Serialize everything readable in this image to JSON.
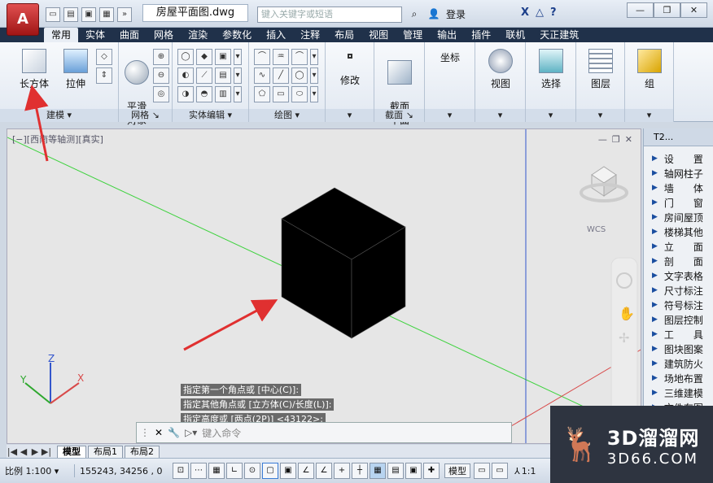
{
  "app": {
    "logo_label": "A",
    "doc_title": "房屋平面图.dwg",
    "search_placeholder": "键入关键字或短语",
    "login_label": "登录",
    "help_label": "?"
  },
  "quick_access": [
    "new-icon",
    "open-icon",
    "save-icon",
    "saveas-icon",
    "more-icon"
  ],
  "window_controls": {
    "minimize": "—",
    "restore": "❐",
    "close": "✕"
  },
  "tabs": [
    {
      "label": "常用",
      "active": true
    },
    {
      "label": "实体"
    },
    {
      "label": "曲面"
    },
    {
      "label": "网格"
    },
    {
      "label": "渲染"
    },
    {
      "label": "参数化"
    },
    {
      "label": "插入"
    },
    {
      "label": "注释"
    },
    {
      "label": "布局"
    },
    {
      "label": "视图"
    },
    {
      "label": "管理"
    },
    {
      "label": "输出"
    },
    {
      "label": "插件"
    },
    {
      "label": "联机"
    },
    {
      "label": "天正建筑"
    }
  ],
  "ribbon": {
    "modeling": {
      "title": "建模 ▾",
      "box_label": "长方体",
      "extrude_label": "拉伸"
    },
    "mesh": {
      "title": "网格 ↘",
      "smooth_label": "平滑\n对象"
    },
    "solid_edit": {
      "title": "实体编辑 ▾"
    },
    "draw": {
      "title": "绘图 ▾"
    },
    "modify": {
      "label": "修改"
    },
    "section": {
      "title": "截面 ↘",
      "label": "截面\n平面"
    },
    "coords": {
      "label": "坐标"
    },
    "view": {
      "label": "视图"
    },
    "select": {
      "label": "选择"
    },
    "layers": {
      "label": "图层"
    },
    "group": {
      "label": "组"
    }
  },
  "viewport": {
    "label": "[−][西南等轴测][真实]",
    "wcs_label": "WCS",
    "axis_x": "X",
    "axis_y": "Y",
    "axis_z": "Z"
  },
  "palette": {
    "title": "T2...",
    "items": [
      "设　　置",
      "轴网柱子",
      "墙　　体",
      "门　　窗",
      "房间屋顶",
      "楼梯其他",
      "立　　面",
      "剖　　面",
      "文字表格",
      "尺寸标注",
      "符号标注",
      "图层控制",
      "工　　具",
      "图块图案",
      "建筑防火",
      "场地布置",
      "三维建模",
      "文件布图"
    ]
  },
  "command": {
    "history": [
      "指定第一个角点或 [中心(C)]:",
      "指定其他角点或 [立方体(C)/长度(L)]:",
      "指定高度或 [两点(2P)] <43122>:"
    ],
    "placeholder": "键入命令"
  },
  "layout_tabs": [
    {
      "label": "模型",
      "active": true
    },
    {
      "label": "布局1"
    },
    {
      "label": "布局2"
    }
  ],
  "status": {
    "scale": "比例 1:100 ▾",
    "coords": "155243, 34256 , 0",
    "model_label": "模型",
    "annotation_scale": "1:1"
  },
  "watermark": {
    "brand": "3D溜溜网",
    "url": "3D66.COM"
  },
  "colors": {
    "accent": "#20314a",
    "annotation_arrow": "#e03030",
    "cube": "#000000"
  }
}
